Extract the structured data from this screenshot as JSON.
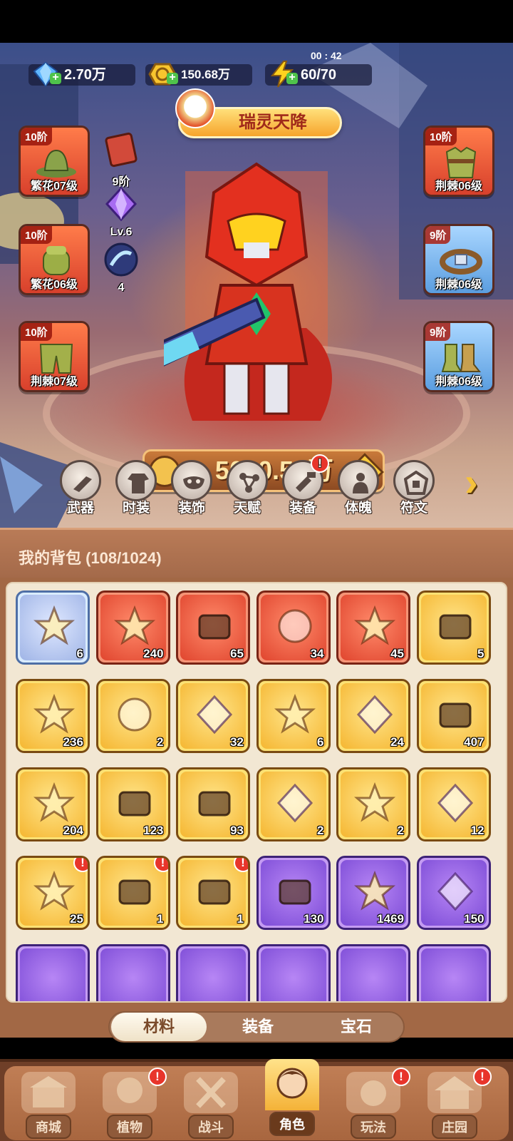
{
  "resources": {
    "diamonds": "2.70万",
    "coins": "150.68万",
    "energy": "60/70",
    "energy_timer": "00 : 42"
  },
  "title_banner": "瑞灵天降",
  "left_slots": [
    {
      "tier": "10阶",
      "level": "繁花07级"
    },
    {
      "tier": "10阶",
      "level": "繁花06级"
    },
    {
      "tier": "10阶",
      "level": "荆棘07级"
    }
  ],
  "right_slots": [
    {
      "tier": "10阶",
      "level": "荆棘06级"
    },
    {
      "tier": "9阶",
      "level": "荆棘06级"
    },
    {
      "tier": "9阶",
      "level": "荆棘06级"
    }
  ],
  "mini_items": [
    {
      "label": "9阶"
    },
    {
      "label": "Lv.6"
    },
    {
      "label": "4"
    }
  ],
  "power": "5000.54万",
  "tabs": [
    {
      "label": "武器",
      "icon": "weapon-icon"
    },
    {
      "label": "时装",
      "icon": "outfit-icon"
    },
    {
      "label": "装饰",
      "icon": "mask-icon"
    },
    {
      "label": "天赋",
      "icon": "talent-icon"
    },
    {
      "label": "装备",
      "icon": "equipment-icon",
      "badge": "!"
    },
    {
      "label": "体魄",
      "icon": "physique-icon"
    },
    {
      "label": "符文",
      "icon": "rune-icon"
    }
  ],
  "backpack": {
    "title": "我的背包 (108/1024)",
    "items": [
      {
        "count": "6",
        "rarity": "blue",
        "icon": "star-icon"
      },
      {
        "count": "240",
        "rarity": "red",
        "icon": "crystal-star-icon"
      },
      {
        "count": "65",
        "rarity": "red",
        "icon": "potion-apple-icon"
      },
      {
        "count": "34",
        "rarity": "red",
        "icon": "green-tube-icon"
      },
      {
        "count": "45",
        "rarity": "red",
        "icon": "rune-flower-icon"
      },
      {
        "count": "5",
        "rarity": "gold",
        "icon": "gold-potion-icon"
      },
      {
        "count": "236",
        "rarity": "gold",
        "icon": "bouquet-icon"
      },
      {
        "count": "2",
        "rarity": "gold",
        "icon": "key-icon"
      },
      {
        "count": "32",
        "rarity": "gold",
        "icon": "prism-icon"
      },
      {
        "count": "6",
        "rarity": "gold",
        "icon": "golden-flower-icon"
      },
      {
        "count": "24",
        "rarity": "gold",
        "icon": "dark-stone-icon"
      },
      {
        "count": "407",
        "rarity": "gold",
        "icon": "orange-potion-icon"
      },
      {
        "count": "204",
        "rarity": "gold",
        "icon": "flower-pot-icon"
      },
      {
        "count": "123",
        "rarity": "gold",
        "icon": "sprayer-icon"
      },
      {
        "count": "93",
        "rarity": "gold",
        "icon": "spell-book-icon"
      },
      {
        "count": "2",
        "rarity": "gold",
        "icon": "amber-gem-icon"
      },
      {
        "count": "2",
        "rarity": "gold",
        "icon": "lily-icon"
      },
      {
        "count": "12",
        "rarity": "gold",
        "icon": "rune-knot-icon"
      },
      {
        "count": "25",
        "rarity": "gold",
        "icon": "flame-icon",
        "badge": "!"
      },
      {
        "count": "1",
        "rarity": "gold",
        "icon": "chest-icon",
        "badge": "!"
      },
      {
        "count": "1",
        "rarity": "gold",
        "icon": "weapon-chest-icon",
        "badge": "!"
      },
      {
        "count": "130",
        "rarity": "purple",
        "icon": "purple-potion-icon"
      },
      {
        "count": "1469",
        "rarity": "purple",
        "icon": "pink-flower-icon"
      },
      {
        "count": "150",
        "rarity": "purple",
        "icon": "rune-badge-icon"
      }
    ]
  },
  "filter": {
    "options": [
      "材料",
      "装备",
      "宝石"
    ],
    "selected": "材料"
  },
  "nav": [
    {
      "label": "商城",
      "icon": "shop-icon"
    },
    {
      "label": "植物",
      "icon": "plant-icon",
      "badge": "!"
    },
    {
      "label": "战斗",
      "icon": "battle-icon"
    },
    {
      "label": "角色",
      "icon": "character-icon",
      "active": true
    },
    {
      "label": "玩法",
      "icon": "gameplay-icon",
      "badge": "!"
    },
    {
      "label": "庄园",
      "icon": "manor-icon",
      "badge": "!"
    }
  ],
  "colors": {
    "accent_gold": "#f5b631",
    "badge_red": "#e8352b",
    "panel_brown": "#a26845"
  }
}
